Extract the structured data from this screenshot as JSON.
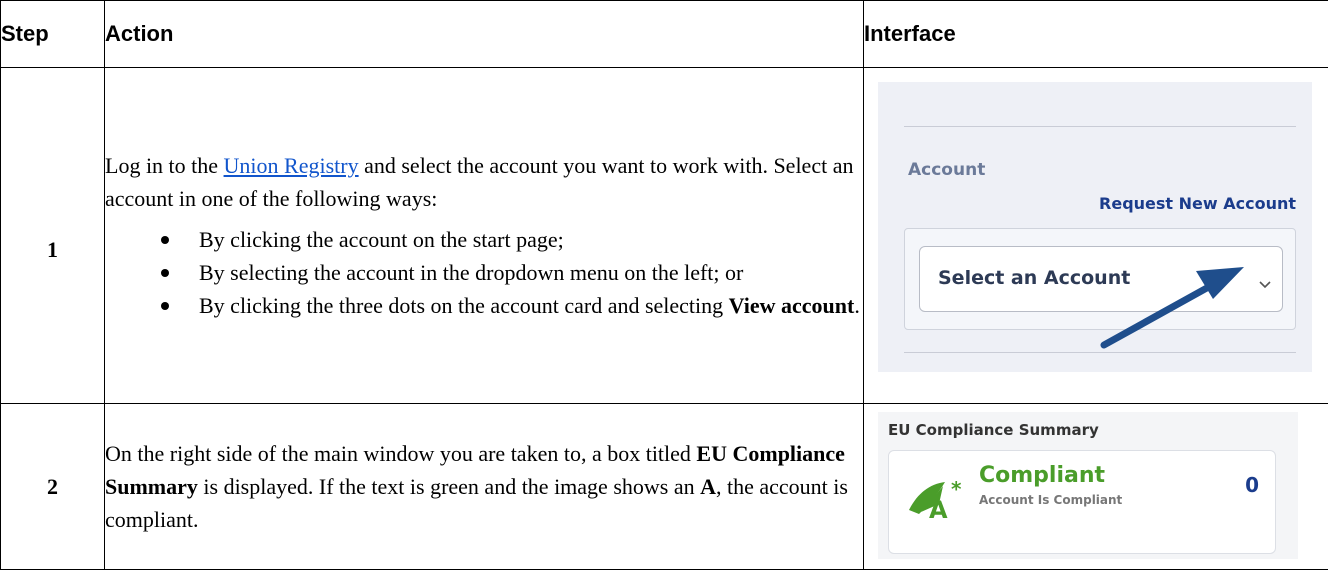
{
  "headers": {
    "step": "Step",
    "action": "Action",
    "interface": "Interface"
  },
  "rows": [
    {
      "step": "1",
      "action": {
        "text_before_link": "Log in to the ",
        "link_text": "Union Registry",
        "text_after_link": " and select the account you want to work with. Select an account in one of the following ways:",
        "bullets": [
          {
            "text": "By clicking the account on the start page;"
          },
          {
            "text": "By selecting the account in the dropdown menu on the left; or"
          },
          {
            "text_before_bold": "By clicking the three dots on the account card and selecting ",
            "bold": "View account",
            "text_after_bold": "."
          }
        ]
      },
      "interface": {
        "account_label": "Account",
        "request_link": "Request New Account",
        "select_placeholder": "Select an Account",
        "chevron_icon": "chevron-down-icon",
        "arrow_color": "#1f4e8c"
      }
    },
    {
      "step": "2",
      "action": {
        "text_1": "On the right side of the main window you are taken to, a box titled ",
        "bold_1": "EU Compliance Summary",
        "text_2": " is displayed. If the text is green and the image shows an ",
        "bold_2": "A",
        "text_3": ", the account is compliant."
      },
      "interface": {
        "summary_title": "EU Compliance Summary",
        "status": "Compliant",
        "status_sub": "Account Is Compliant",
        "count": "0",
        "status_color": "#4a9d2a",
        "icon": "compliance-a-icon"
      }
    }
  ]
}
